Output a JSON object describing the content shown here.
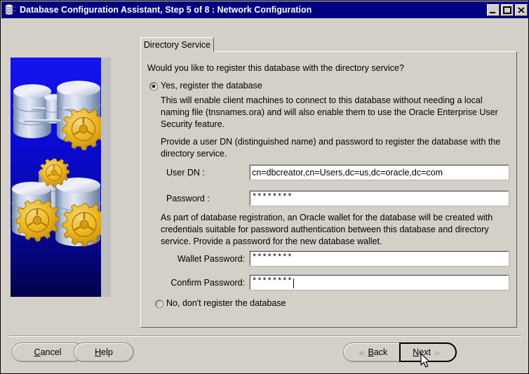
{
  "window": {
    "title": "Database Configuration Assistant, Step 5 of 8 : Network Configuration",
    "icon": "database-icon",
    "controls": {
      "minimize": "minimize-icon",
      "maximize": "maximize-icon",
      "close": "close-icon"
    },
    "colors": {
      "titlebar": "#000080",
      "face": "#d4d0c8",
      "graphic_bg": "#0000e0",
      "gear": "#f5b800"
    }
  },
  "tab": {
    "label": "Directory Service"
  },
  "content": {
    "question": "Would you like to register this database with the directory service?",
    "option_yes": {
      "label": "Yes, register the database",
      "selected": true
    },
    "yes_description": "This will enable client machines to connect to this database without needing a local naming file (tnsnames.ora) and will also enable them to use the Oracle Enterprise User Security feature.",
    "dn_instruction": "Provide a user DN (distinguished name) and password to register the database with the directory service.",
    "user_dn": {
      "label": "User DN :",
      "value": "cn=dbcreator,cn=Users,dc=us,dc=oracle,dc=com"
    },
    "password": {
      "label": "Password :",
      "value": "********"
    },
    "wallet_instruction": "As part of database registration, an Oracle wallet for the database will be created with credentials suitable for password authentication between this database and directory service. Provide a password for the new database wallet.",
    "wallet_password": {
      "label": "Wallet Password:",
      "value": "********"
    },
    "confirm_password": {
      "label": "Confirm Password:",
      "value": "********",
      "focused": true
    },
    "option_no": {
      "label": "No, don't register the database",
      "selected": false
    }
  },
  "buttons": {
    "cancel": "Cancel",
    "help": "Help",
    "back": "Back",
    "next": "Next",
    "back_icon": "double-chevron-left-icon",
    "next_icon": "double-chevron-right-icon"
  }
}
